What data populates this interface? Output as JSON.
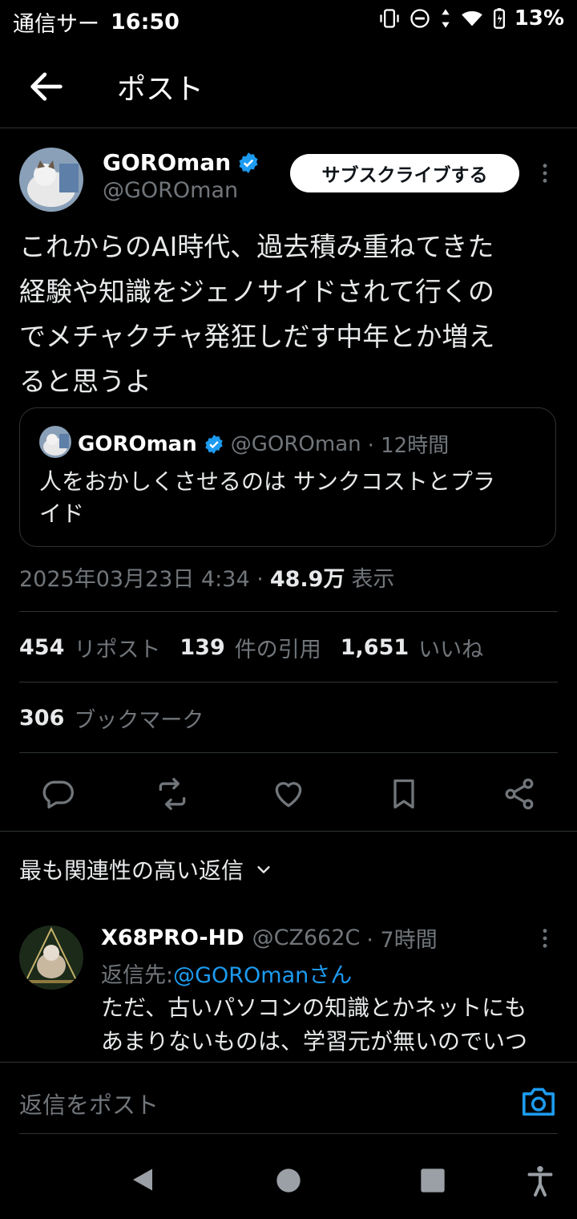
{
  "status_bar": {
    "carrier": "通信サー",
    "time": "16:50",
    "battery": "13%"
  },
  "header": {
    "title": "ポスト"
  },
  "post": {
    "author_name": "GOROman",
    "author_handle": "@GOROman",
    "subscribe_label": "サブスクライブする",
    "text_lines": [
      "これからのAI時代、過去積み重ねてきた",
      "経験や知識をジェノサイドされて行くの",
      "でメチャクチャ発狂しだす中年とか増え",
      "ると思うよ"
    ],
    "quote": {
      "author_name": "GOROman",
      "author_handle": "@GOROman",
      "time": "· 12時間",
      "text_lines": [
        "人をおかしくさせるのは サンクコストとプラ",
        "イド"
      ]
    },
    "meta": {
      "datetime": "2025年03月23日 4:34 ·",
      "views_num": "48.9万",
      "views_label": "表示"
    },
    "stats": {
      "reposts_num": "454",
      "reposts_label": "リポスト",
      "quotes_num": "139",
      "quotes_label": "件の引用",
      "likes_num": "1,651",
      "likes_label": "いいね",
      "bookmarks_num": "306",
      "bookmarks_label": "ブックマーク"
    }
  },
  "replies": {
    "sort_label": "最も関連性の高い返信",
    "items": [
      {
        "name": "X68PRO-HD",
        "handle": "@CZ662C",
        "time": "· 7時間",
        "reply_to_prefix": "返信先: ",
        "reply_to_handle": "@GOROmanさん",
        "text_lines": [
          "ただ、古いパソコンの知識とかネットにも",
          "あまりないものは、学習元が無いのでいつ"
        ]
      }
    ]
  },
  "compose": {
    "placeholder": "返信をポスト"
  },
  "colors": {
    "accent": "#1d9bf0",
    "verified": "#1d9bf0",
    "background": "#000000",
    "text": "#e7e9ea",
    "muted": "#71767b",
    "border": "#2f3336"
  }
}
